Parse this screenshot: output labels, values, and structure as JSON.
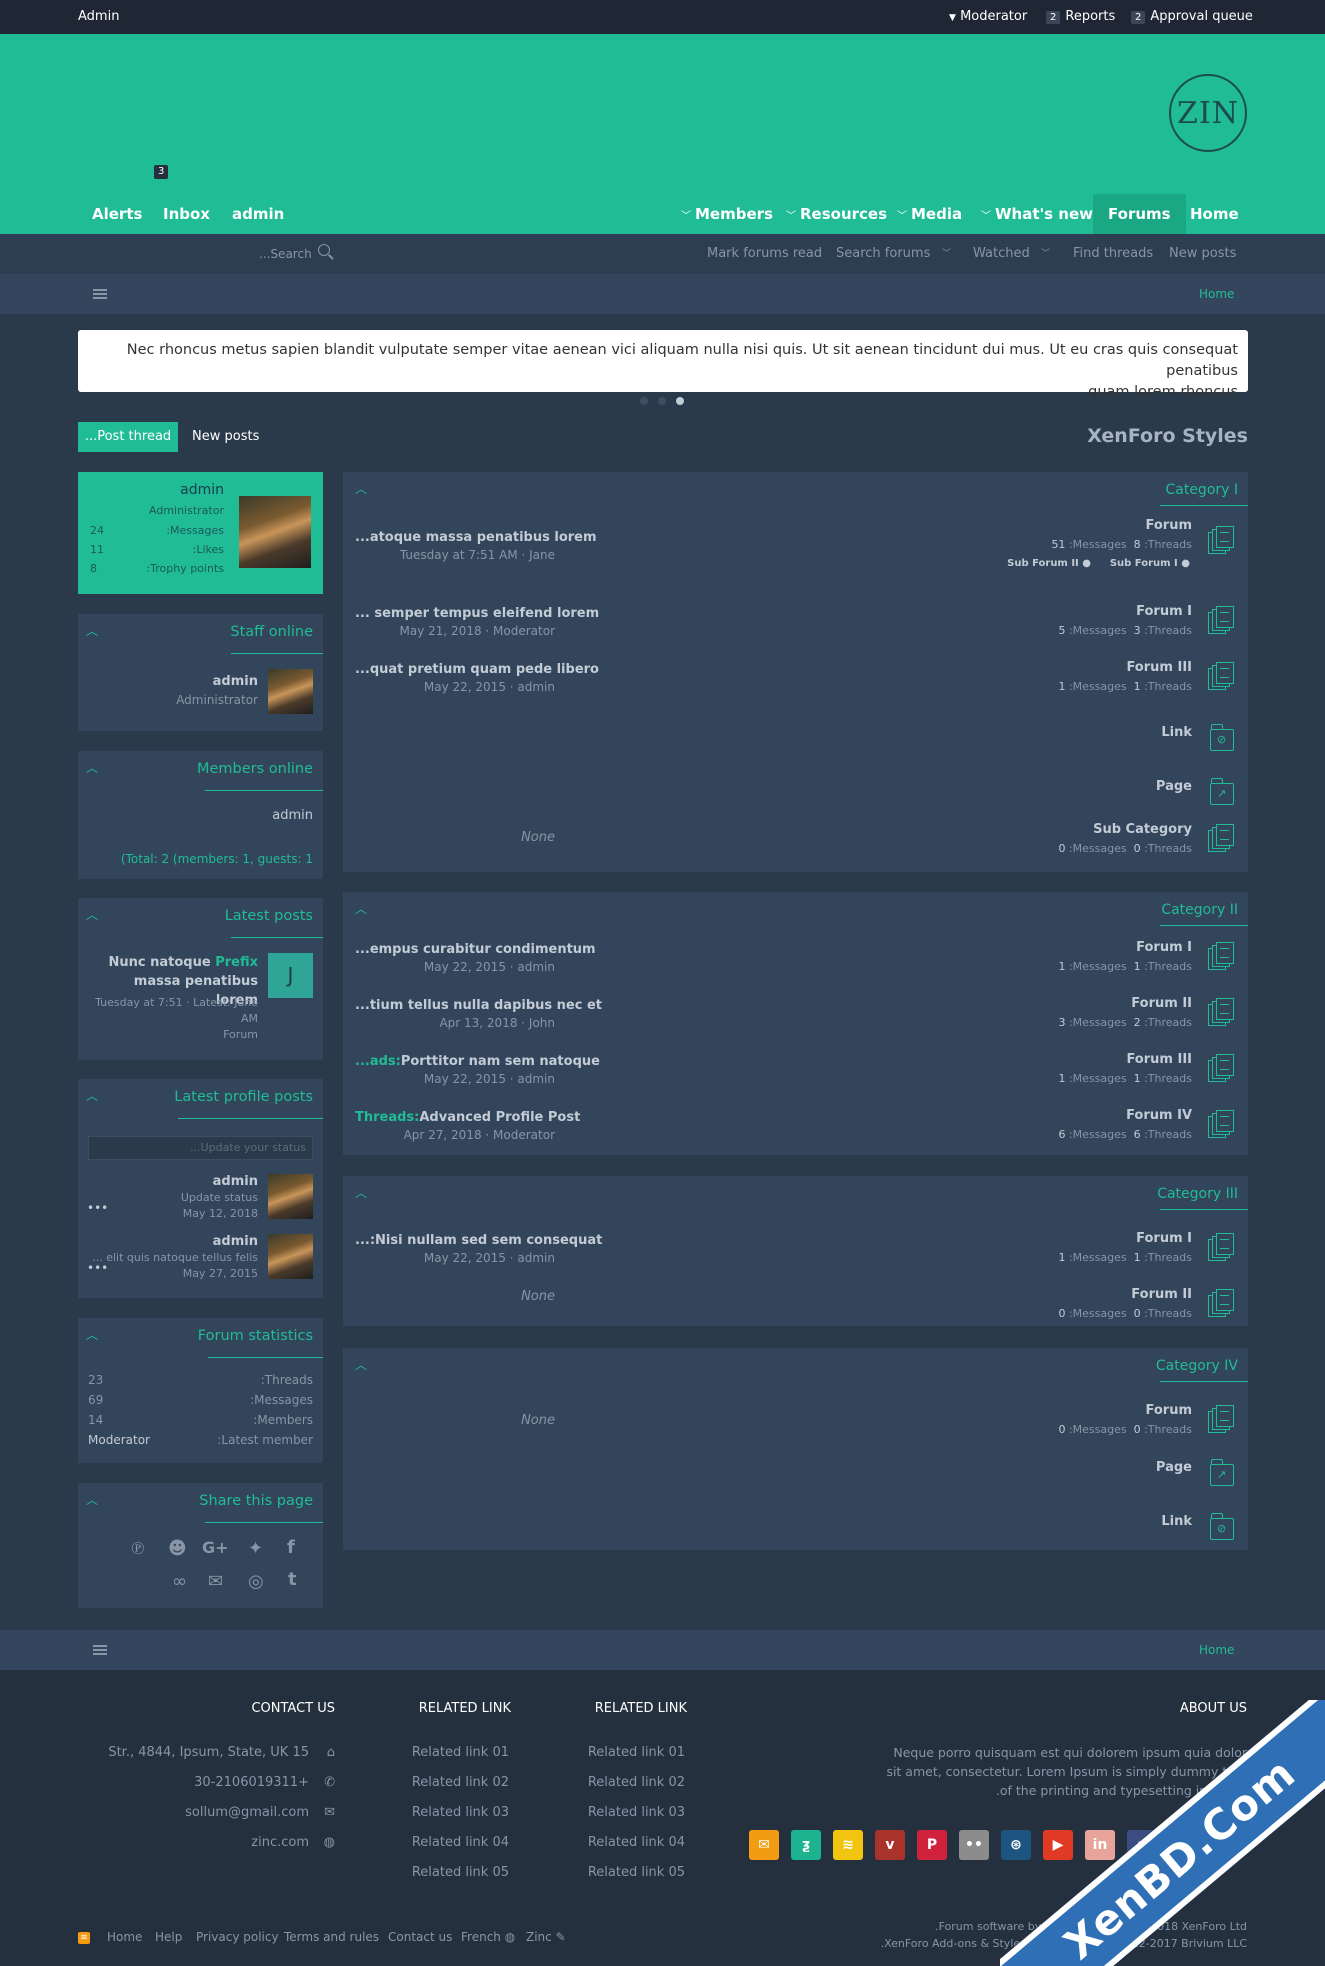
{
  "topbar": {
    "user": "Admin",
    "moderator": "Moderator",
    "reports_count": "2",
    "reports": "Reports",
    "approval_count": "2",
    "approval": "Approval queue"
  },
  "logo": {
    "text": "ZIN"
  },
  "nav": {
    "alerts": "Alerts",
    "inbox": "Inbox",
    "inbox_badge": "3",
    "account": "admin",
    "members": "Members",
    "resources": "Resources",
    "media": "Media",
    "whats_new": "What's new",
    "forums": "Forums",
    "home": "Home"
  },
  "subnav": {
    "search_placeholder": "...Search",
    "mark_read": "Mark forums read",
    "search_forums": "Search forums",
    "watched": "Watched",
    "find_threads": "Find threads",
    "new_posts": "New posts"
  },
  "breadcrumb": {
    "home": "Home"
  },
  "notice": {
    "line1": "Nec rhoncus metus sapien blandit vulputate semper vitae aenean vici aliquam nulla nisi quis. Ut sit aenean tincidunt dui mus. Ut eu cras quis consequat penatibus",
    "line2": ".quam lorem rhoncus"
  },
  "actions": {
    "post_thread": "...Post thread",
    "new_posts": "New posts",
    "page_title": "XenForo Styles"
  },
  "profile_card": {
    "name": "admin",
    "role": "Administrator",
    "stats": [
      {
        "value": "24",
        "label": ":Messages"
      },
      {
        "value": "11",
        "label": ":Likes"
      },
      {
        "value": "8",
        "label": ":Trophy points"
      }
    ]
  },
  "staff_online": {
    "title": "Staff online",
    "name": "admin",
    "role": "Administrator"
  },
  "members_online": {
    "title": "Members online",
    "name": "admin",
    "total": "(Total: 2 (members: 1, guests: 1"
  },
  "latest_posts": {
    "title": "Latest posts",
    "prefix": "Prefix",
    "thread_a": "Nunc natoque",
    "thread_b": "massa penatibus lorem",
    "meta_a": "Tuesday at 7:51 · Latest: Jane",
    "meta_b": "AM",
    "forum": "Forum",
    "avatar_letter": "J"
  },
  "profile_posts": {
    "title": "Latest profile posts",
    "placeholder": "...Update your status",
    "items": [
      {
        "name": "admin",
        "text": "Update status",
        "date": "May 12, 2018"
      },
      {
        "name": "admin",
        "text": "... elit quis natoque tellus felis",
        "date": "May 27, 2015"
      }
    ]
  },
  "forum_stats": {
    "title": "Forum statistics",
    "rows": [
      {
        "value": "23",
        "label": ":Threads"
      },
      {
        "value": "69",
        "label": ":Messages"
      },
      {
        "value": "14",
        "label": ":Members"
      },
      {
        "value": "Moderator",
        "label": ":Latest member"
      }
    ]
  },
  "share": {
    "title": "Share this page"
  },
  "categories": [
    {
      "title": "Category I",
      "rows": [
        {
          "forum": "Forum",
          "messages": "51",
          "threads": "8",
          "last_title": "...atoque massa penatibus lorem",
          "last_meta": "Tuesday at 7:51 AM · Jane",
          "sub1": "Sub Forum II",
          "sub2": "Sub Forum I"
        },
        {
          "forum": "Forum I",
          "messages": "5",
          "threads": "3",
          "last_title": "... semper tempus eleifend lorem",
          "last_meta": "May 21, 2018 · Moderator"
        },
        {
          "forum": "Forum III",
          "messages": "1",
          "threads": "1",
          "last_title": "...quat pretium quam pede libero",
          "last_meta": "May 22, 2015 · admin"
        },
        {
          "forum": "Link"
        },
        {
          "forum": "Page"
        },
        {
          "forum": "Sub Category",
          "messages": "0",
          "threads": "0",
          "none": "None"
        }
      ]
    },
    {
      "title": "Category II",
      "rows": [
        {
          "forum": "Forum I",
          "messages": "1",
          "threads": "1",
          "last_title": "...empus curabitur condimentum",
          "last_meta": "May 22, 2015 · admin"
        },
        {
          "forum": "Forum II",
          "messages": "3",
          "threads": "2",
          "last_title": "...tium tellus nulla dapibus nec et",
          "last_meta": "Apr 13, 2018 · John"
        },
        {
          "forum": "Forum III",
          "messages": "1",
          "threads": "1",
          "last_prefix": "...ads:",
          "last_title": "Porttitor nam sem natoque",
          "last_meta": "May 22, 2015 · admin"
        },
        {
          "forum": "Forum IV",
          "messages": "6",
          "threads": "6",
          "last_prefix": "Threads:",
          "last_title": "Advanced Profile Post",
          "last_meta": "Apr 27, 2018 · Moderator"
        }
      ]
    },
    {
      "title": "Category III",
      "rows": [
        {
          "forum": "Forum I",
          "messages": "1",
          "threads": "1",
          "last_title": "...:Nisi nullam sed sem consequat",
          "last_meta": "May 22, 2015 · admin"
        },
        {
          "forum": "Forum II",
          "messages": "0",
          "threads": "0",
          "none": "None"
        }
      ]
    },
    {
      "title": "Category IV",
      "rows": [
        {
          "forum": "Forum",
          "messages": "0",
          "threads": "0",
          "none": "None"
        },
        {
          "forum": "Page"
        },
        {
          "forum": "Link"
        }
      ]
    }
  ],
  "labels": {
    "messages": ":Messages",
    "threads": ":Threads"
  },
  "footer": {
    "contact_title": "CONTACT US",
    "contact": [
      "Str., 4844, Ipsum, State, UK 15",
      "30-2106019311+",
      "sollum@gmail.com",
      "zinc.com"
    ],
    "related_title": "RELATED LINK",
    "related": [
      "Related link 01",
      "Related link 02",
      "Related link 03",
      "Related link 04",
      "Related link 05"
    ],
    "about_title": "ABOUT US",
    "about": [
      "Neque porro quisquam est qui dolorem ipsum quia dolor",
      "sit amet, consectetur. Lorem Ipsum is simply dummy text",
      ".of the printing and typesetting industry"
    ],
    "bottom_links": [
      "Home",
      "Help",
      "Privacy policy",
      "Terms and rules",
      "Contact us",
      "French",
      "Zinc"
    ],
    "copyright1": ".Forum software by XenForo® © 2010-2018 XenForo Ltd",
    "copyright2": ".XenForo Add-ons & Styles by Brivium™ © 2012-2017 Brivium LLC",
    "watermark": "XenBD.Com"
  },
  "colors": {
    "accent": "#20bc96",
    "background": "#2b3a4b",
    "panel": "#33455b",
    "topbar": "#1f2734"
  }
}
